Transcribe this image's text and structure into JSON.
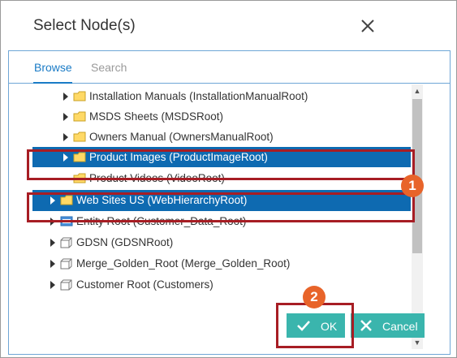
{
  "dialog": {
    "title": "Select Node(s)",
    "close_icon": "close-icon"
  },
  "tabs": [
    {
      "label": "Browse",
      "active": true
    },
    {
      "label": "Search",
      "active": false
    }
  ],
  "tree": {
    "rows": [
      {
        "label": "Installation Manuals (InstallationManualRoot)",
        "icon": "folder-icon",
        "expandable": true,
        "selected": false
      },
      {
        "label": "MSDS Sheets (MSDSRoot)",
        "icon": "folder-icon",
        "expandable": true,
        "selected": false
      },
      {
        "label": "Owners Manual (OwnersManualRoot)",
        "icon": "folder-icon",
        "expandable": true,
        "selected": false
      },
      {
        "label": "Product Images (ProductImageRoot)",
        "icon": "folder-icon",
        "expandable": true,
        "selected": true
      },
      {
        "label": "Product Videos (VideoRoot)",
        "icon": "folder-icon",
        "expandable": false,
        "selected": false
      },
      {
        "label": "Web Sites US (WebHierarchyRoot)",
        "icon": "folder-icon",
        "expandable": true,
        "selected": true
      },
      {
        "label": "Entity Root (Customer_Data_Root)",
        "icon": "entity-icon",
        "expandable": true,
        "selected": false
      },
      {
        "label": "GDSN (GDSNRoot)",
        "icon": "cube-icon",
        "expandable": true,
        "selected": false
      },
      {
        "label": "Merge_Golden_Root (Merge_Golden_Root)",
        "icon": "cube-icon",
        "expandable": true,
        "selected": false
      },
      {
        "label": "Customer Root (Customers)",
        "icon": "cube-icon",
        "expandable": true,
        "selected": false
      }
    ]
  },
  "callouts": {
    "marker1": "1",
    "marker2": "2"
  },
  "buttons": {
    "ok_label": "OK",
    "cancel_label": "Cancel"
  },
  "colors": {
    "selection": "#0e6ab1",
    "accent": "#1a7bc6",
    "button": "#3ab5ad",
    "highlight_box": "#a71d24",
    "marker": "#e8642a",
    "folder": "#ffd966"
  }
}
